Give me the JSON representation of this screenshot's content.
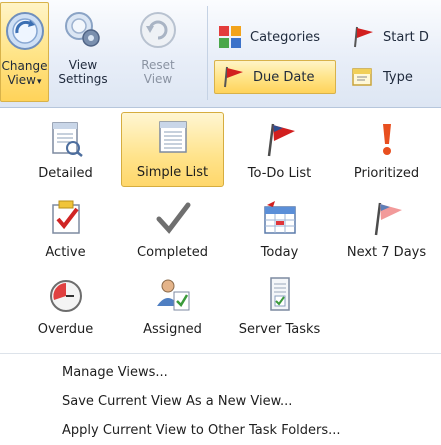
{
  "ribbon": {
    "change_view": {
      "line1": "Change",
      "line2": "View",
      "dropdown": "▾",
      "icon": "change-view-icon"
    },
    "view_settings": {
      "line1": "View",
      "line2": "Settings",
      "icon": "view-settings-icon"
    },
    "reset_view": {
      "line1": "Reset",
      "line2": "View",
      "icon": "reset-view-icon"
    },
    "categories": {
      "label": "Categories",
      "icon": "categories-icon"
    },
    "start_date": {
      "label": "Start D",
      "icon": "start-date-flag-icon"
    },
    "due_date": {
      "label": "Due Date",
      "icon": "due-date-flag-icon"
    },
    "type": {
      "label": "Type",
      "icon": "type-icon"
    }
  },
  "views": [
    {
      "label": "Detailed",
      "icon": "detailed-view-icon",
      "selected": false
    },
    {
      "label": "Simple List",
      "icon": "simple-list-icon",
      "selected": true
    },
    {
      "label": "To-Do List",
      "icon": "todo-flag-icon",
      "selected": false
    },
    {
      "label": "Prioritized",
      "icon": "priority-icon",
      "selected": false
    },
    {
      "label": "Active",
      "icon": "active-check-icon",
      "selected": false
    },
    {
      "label": "Completed",
      "icon": "completed-check-icon",
      "selected": false
    },
    {
      "label": "Today",
      "icon": "calendar-today-icon",
      "selected": false
    },
    {
      "label": "Next 7 Days",
      "icon": "next-7-days-flag-icon",
      "selected": false
    },
    {
      "label": "Overdue",
      "icon": "overdue-clock-icon",
      "selected": false
    },
    {
      "label": "Assigned",
      "icon": "assigned-icon",
      "selected": false
    },
    {
      "label": "Server Tasks",
      "icon": "server-tasks-icon",
      "selected": false
    }
  ],
  "menu": {
    "manage_views": "Manage Views...",
    "save_view": "Save Current View As a New View...",
    "apply_view": "Apply Current View to Other Task Folders..."
  },
  "colors": {
    "highlight": "#ffe38b",
    "highlight_border": "#d6ad3f",
    "ribbon_bg": "#e8eef8",
    "flag_red": "#d21f1f"
  }
}
